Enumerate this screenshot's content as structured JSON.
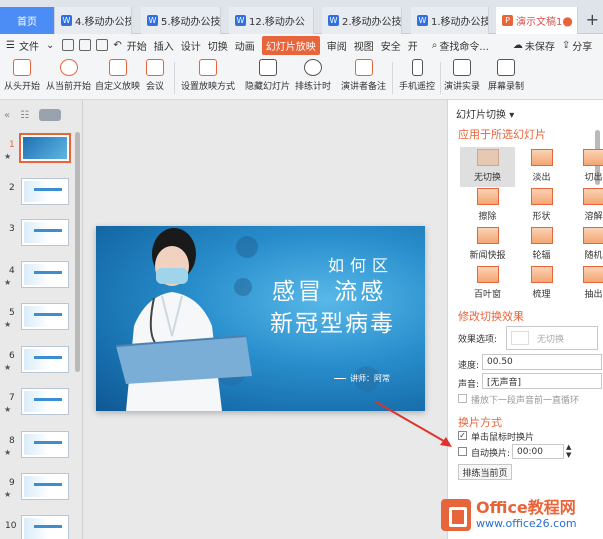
{
  "tabs": [
    {
      "label": "首页"
    },
    {
      "label": "4.移动办公技"
    },
    {
      "label": "5.移动办公技"
    },
    {
      "label": "12.移动办公"
    },
    {
      "label": "2.移动办公技"
    },
    {
      "label": "1.移动办公技"
    },
    {
      "label": "演示文稿1"
    }
  ],
  "menu": {
    "file": "文件",
    "items": [
      "开始",
      "插入",
      "设计",
      "切换",
      "动画",
      "幻灯片放映",
      "审阅",
      "视图",
      "安全",
      "开"
    ],
    "active": "幻灯片放映",
    "search": "查找命令...",
    "unsaved": "未保存",
    "share": "分享"
  },
  "ribbon": [
    "从头开始",
    "从当前开始",
    "自定义放映",
    "会议",
    "设置放映方式",
    "隐藏幻灯片",
    "排练计时",
    "演讲者备注",
    "手机遥控",
    "演讲实录",
    "屏幕录制"
  ],
  "thumbnails": [
    {
      "num": "1"
    },
    {
      "num": "2"
    },
    {
      "num": "3"
    },
    {
      "num": "4"
    },
    {
      "num": "5"
    },
    {
      "num": "6"
    },
    {
      "num": "7"
    },
    {
      "num": "8"
    },
    {
      "num": "9"
    },
    {
      "num": "10"
    }
  ],
  "slide": {
    "title_top": "如何区",
    "title_line1": "感冒  流感",
    "title_line2": "新冠型病毒",
    "speaker": "讲师：阿常"
  },
  "panel": {
    "title": "幻灯片切换",
    "apply_to": "应用于所选幻灯片",
    "transitions": [
      "无切换",
      "淡出",
      "切出",
      "擦除",
      "形状",
      "溶解",
      "新闻快报",
      "轮辐",
      "随机",
      "百叶窗",
      "梳理",
      "抽出"
    ],
    "modify_section": "修改切换效果",
    "effect_label": "效果选项:",
    "effect_value": "无切换",
    "speed_label": "速度:",
    "speed_value": "00.50",
    "sound_label": "声音:",
    "sound_value": "[无声音]",
    "loop_label": "播放下一段声音前一直循环",
    "advance_section": "换片方式",
    "on_click_label": "单击鼠标时换片",
    "auto_label": "自动换片:",
    "auto_value": "00:00",
    "rehearse_button": "排练当前页"
  },
  "watermark": {
    "title": "Office教程网",
    "url": "www.office26.com"
  },
  "colors": {
    "accent": "#e8643a",
    "tab_home": "#4c8cf5",
    "slide_blue": "#1f7fc0"
  }
}
